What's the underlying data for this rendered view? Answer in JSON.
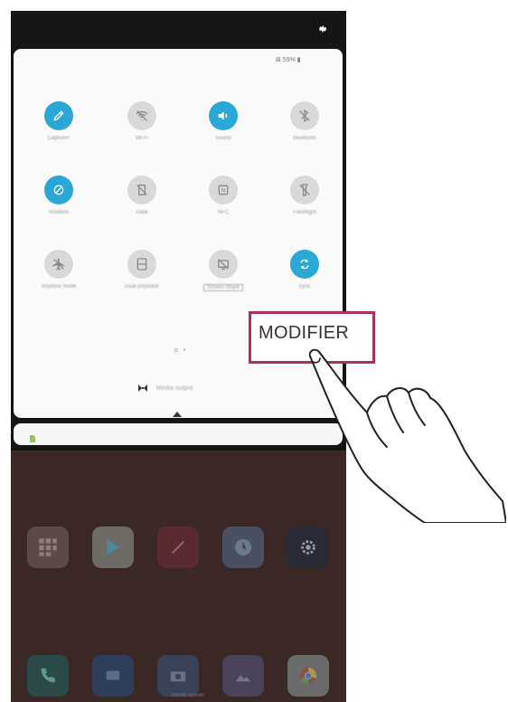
{
  "status_bar": {
    "text": "⊠ 59% ▮"
  },
  "quick_settings": {
    "tiles": [
      {
        "label": "Capture+",
        "active": true,
        "icon": "capture-plus-icon"
      },
      {
        "label": "Wi-Fi",
        "active": false,
        "icon": "wifi-icon"
      },
      {
        "label": "Sound",
        "active": true,
        "icon": "sound-icon"
      },
      {
        "label": "Bluetooth",
        "active": false,
        "icon": "bluetooth-icon"
      },
      {
        "label": "Rotation",
        "active": true,
        "icon": "rotation-icon"
      },
      {
        "label": "Data",
        "active": false,
        "icon": "data-icon"
      },
      {
        "label": "NFC",
        "active": false,
        "icon": "nfc-icon"
      },
      {
        "label": "Flashlight",
        "active": false,
        "icon": "flashlight-icon"
      },
      {
        "label": "Airplane mode",
        "active": false,
        "icon": "airplane-icon"
      },
      {
        "label": "Dual playback",
        "active": false,
        "icon": "dual-playback-icon"
      },
      {
        "label": "Screen share",
        "active": false,
        "icon": "screen-share-icon"
      },
      {
        "label": "Sync",
        "active": true,
        "icon": "sync-icon"
      }
    ],
    "page_indicator": "o •",
    "media_output_label": "Media output"
  },
  "callout": {
    "label": "MODIFIER"
  },
  "dock": {
    "label": "Home screen"
  },
  "colors": {
    "accent": "#2aa7d4",
    "callout_border": "#b0305c",
    "panel_bg": "#fafafa",
    "home_bg": "#3a2827"
  }
}
